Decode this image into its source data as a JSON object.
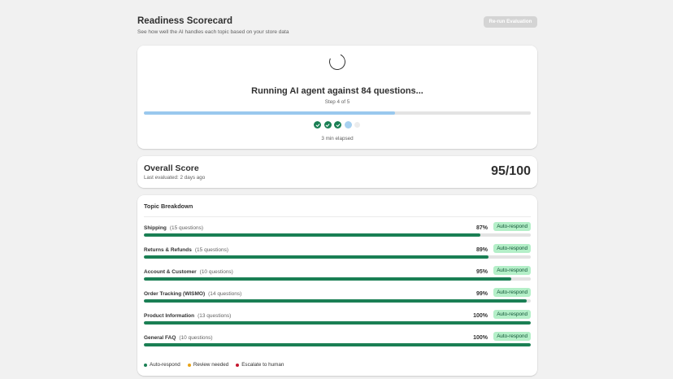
{
  "header": {
    "title": "Readiness Scorecard",
    "subtitle": "See how well the AI handles each topic based on your store data",
    "rerun_label": "Re-run Evaluation"
  },
  "run": {
    "title": "Running AI agent against 84 questions...",
    "step_text": "Step 4 of 5",
    "progress": 0.65,
    "steps": [
      "done",
      "done",
      "done",
      "active",
      "pending"
    ],
    "elapsed": "3 min elapsed"
  },
  "overall": {
    "title": "Overall Score",
    "last_evaluated": "Last evaluated: 2 days ago",
    "score": "95/100"
  },
  "breakdown": {
    "title": "Topic Breakdown",
    "topics": [
      {
        "name": "Shipping",
        "count": "(15 questions)",
        "percent": "87%",
        "value": 0.87,
        "badge": "Auto-respond"
      },
      {
        "name": "Returns & Refunds",
        "count": "(15 questions)",
        "percent": "89%",
        "value": 0.89,
        "badge": "Auto-respond"
      },
      {
        "name": "Account & Customer",
        "count": "(10 questions)",
        "percent": "95%",
        "value": 0.95,
        "badge": "Auto-respond"
      },
      {
        "name": "Order Tracking (WISMO)",
        "count": "(14 questions)",
        "percent": "99%",
        "value": 0.99,
        "badge": "Auto-respond"
      },
      {
        "name": "Product Information",
        "count": "(13 questions)",
        "percent": "100%",
        "value": 1.0,
        "badge": "Auto-respond"
      },
      {
        "name": "General FAQ",
        "count": "(10 questions)",
        "percent": "100%",
        "value": 1.0,
        "badge": "Auto-respond"
      }
    ],
    "legend": [
      {
        "label": "Auto-respond",
        "color": "#1a7f54"
      },
      {
        "label": "Review needed",
        "color": "#e8a317"
      },
      {
        "label": "Escalate to human",
        "color": "#c5162e"
      }
    ]
  }
}
